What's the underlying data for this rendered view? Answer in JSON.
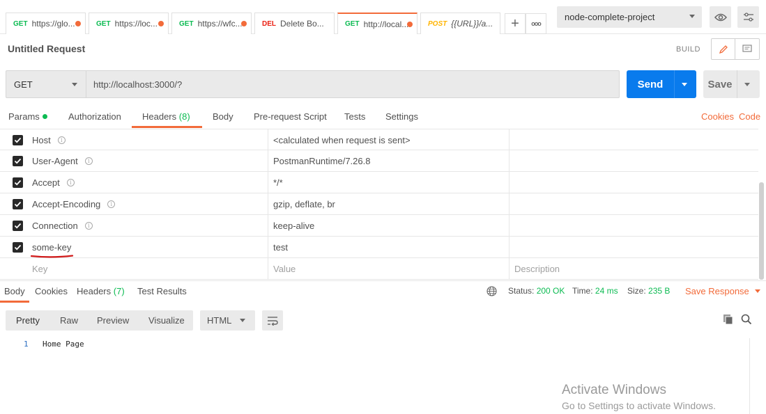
{
  "tabs": [
    {
      "method": "GET",
      "title": "https://glo..."
    },
    {
      "method": "GET",
      "title": "https://loc..."
    },
    {
      "method": "GET",
      "title": "https://wfc..."
    },
    {
      "method": "DEL",
      "title": "Delete Bo..."
    },
    {
      "method": "GET",
      "title": "http://local..."
    },
    {
      "method": "POST",
      "title": "{{URL}}/a..."
    }
  ],
  "tab_controls": {
    "add": "+",
    "more": "ooo"
  },
  "environment": {
    "selected": "node-complete-project"
  },
  "request": {
    "title": "Untitled Request",
    "build_label": "BUILD",
    "method": "GET",
    "url": "http://localhost:3000/?",
    "send_label": "Send",
    "save_label": "Save"
  },
  "request_tabs": {
    "params": "Params",
    "authorization": "Authorization",
    "headers": "Headers",
    "headers_count": "(8)",
    "body": "Body",
    "prerequest": "Pre-request Script",
    "tests": "Tests",
    "settings": "Settings",
    "cookies": "Cookies",
    "code": "Code"
  },
  "headers": {
    "rows": [
      {
        "key": "Host",
        "value": "<calculated when request is sent>"
      },
      {
        "key": "User-Agent",
        "value": "PostmanRuntime/7.26.8"
      },
      {
        "key": "Accept",
        "value": "*/*"
      },
      {
        "key": "Accept-Encoding",
        "value": "gzip, deflate, br"
      },
      {
        "key": "Connection",
        "value": "keep-alive"
      },
      {
        "key": "some-key",
        "value": "test"
      }
    ],
    "placeholder": {
      "key": "Key",
      "value": "Value",
      "description": "Description"
    }
  },
  "response": {
    "tabs": {
      "body": "Body",
      "cookies": "Cookies",
      "headers": "Headers",
      "headers_count": "(7)",
      "test_results": "Test Results"
    },
    "status_label": "Status:",
    "status_value": "200 OK",
    "time_label": "Time:",
    "time_value": "24 ms",
    "size_label": "Size:",
    "size_value": "235 B",
    "save_response": "Save Response",
    "formats": {
      "pretty": "Pretty",
      "raw": "Raw",
      "preview": "Preview",
      "visualize": "Visualize"
    },
    "language": "HTML",
    "lines": [
      {
        "no": "1",
        "text": "Home Page"
      }
    ]
  },
  "watermark": {
    "line1": "Activate Windows",
    "line2": "Go to Settings to activate Windows."
  },
  "colors": {
    "accent": "#f26b3a",
    "send": "#097bed",
    "get": "#0cbb52",
    "del": "#eb2013",
    "post": "#ffb400"
  }
}
